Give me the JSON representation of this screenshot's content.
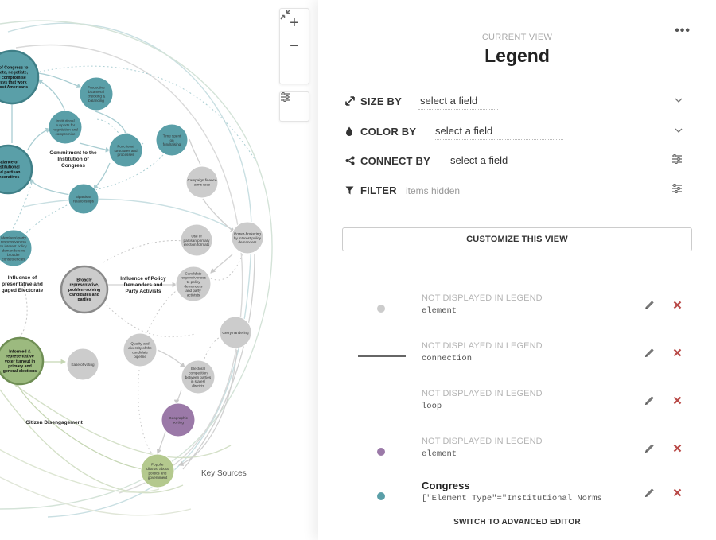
{
  "map": {
    "nodes": [
      {
        "id": "congress",
        "label": [
          "y of Congress to",
          "erate, negotiate,",
          "d compromise",
          "ways that work",
          "most Americans"
        ],
        "color": "#5a9fa8",
        "kind": "big"
      },
      {
        "id": "productive",
        "label": [
          "Productive",
          "bicameral",
          "checking &",
          "balancing"
        ],
        "color": "#5a9fa8"
      },
      {
        "id": "institutional",
        "label": [
          "Institutional",
          "supports for",
          "negotiation and",
          "compromise"
        ],
        "color": "#5a9fa8"
      },
      {
        "id": "functional",
        "label": [
          "Functional",
          "structures and",
          "processes"
        ],
        "color": "#5a9fa8"
      },
      {
        "id": "timespent",
        "label": [
          "Time spent",
          "on",
          "fundraising"
        ],
        "color": "#5a9fa8"
      },
      {
        "id": "balance",
        "label": [
          "Balance of",
          "institutional",
          "and partisan",
          "imperatives"
        ],
        "color": "#5a9fa8",
        "kind": "big"
      },
      {
        "id": "bipartisan",
        "label": [
          "Bipartisan",
          "relationships"
        ],
        "color": "#5a9fa8"
      },
      {
        "id": "campaign",
        "label": [
          "Campaign finance",
          "arms race"
        ],
        "color": "#cccccc"
      },
      {
        "id": "members",
        "label": [
          "Members'/party",
          "responsiveness",
          "to interest policy",
          "demanders vs",
          "broader",
          "constituencies"
        ],
        "color": "#5a9fa8"
      },
      {
        "id": "usepartisan",
        "label": [
          "Use of",
          "partisan primary",
          "election formats"
        ],
        "color": "#cccccc"
      },
      {
        "id": "powerbroker",
        "label": [
          "Power-brokering",
          "by interest policy",
          "demanders"
        ],
        "color": "#cccccc"
      },
      {
        "id": "broadly",
        "label": [
          "Broadly",
          "representative,",
          "problem-solving",
          "candidates and",
          "parties"
        ],
        "color": "#cccccc",
        "kind": "big"
      },
      {
        "id": "candidate",
        "label": [
          "Candidate",
          "responsiveness",
          "to policy",
          "demanders",
          "and party",
          "activists"
        ],
        "color": "#cccccc"
      },
      {
        "id": "gerrymander",
        "label": [
          "Gerrymandering"
        ],
        "color": "#cccccc"
      },
      {
        "id": "quality",
        "label": [
          "Quality and",
          "diversity of the",
          "candidate",
          "pipeline"
        ],
        "color": "#cccccc"
      },
      {
        "id": "informed",
        "label": [
          "Informed &",
          "representative",
          "voter turnout in",
          "primary and",
          "general elections"
        ],
        "color": "#9cba7f",
        "kind": "big"
      },
      {
        "id": "easevoting",
        "label": [
          "Ease of voting"
        ],
        "color": "#cccccc"
      },
      {
        "id": "electoral",
        "label": [
          "Electoral",
          "competition",
          "between parties",
          "in states/",
          "districts"
        ],
        "color": "#cccccc"
      },
      {
        "id": "geographic",
        "label": [
          "Geographic",
          "sorting"
        ],
        "color": "#9b79a8"
      },
      {
        "id": "popular",
        "label": [
          "Popular",
          "distrust about",
          "politics and",
          "government"
        ],
        "color": "#b4c98e"
      }
    ],
    "clusters": [
      {
        "id": "commitment",
        "label": [
          "Commitment to the",
          "Institution of",
          "Congress"
        ]
      },
      {
        "id": "influence-policy",
        "label": [
          "Influence of Policy",
          "Demanders and",
          "Party Activists"
        ]
      },
      {
        "id": "influence-rep",
        "label": [
          "Influence of",
          "presentative and",
          "gaged Electorate"
        ]
      },
      {
        "id": "disengagement",
        "label": [
          "Citizen Disengagement"
        ]
      }
    ],
    "key_sources": "Key Sources"
  },
  "controls": {
    "zoom_in": "+",
    "zoom_out": "−",
    "fit": "⤡"
  },
  "panel": {
    "more": "•••",
    "current_view": "CURRENT VIEW",
    "title": "Legend",
    "size_by": {
      "label": "SIZE BY",
      "value": "select a field"
    },
    "color_by": {
      "label": "COLOR BY",
      "value": "select a field"
    },
    "connect_by": {
      "label": "CONNECT BY",
      "value": "select a field"
    },
    "filter": {
      "label": "FILTER",
      "value": "items hidden"
    },
    "customize": "CUSTOMIZE THIS VIEW",
    "legend_items": [
      {
        "title": "NOT DISPLAYED IN LEGEND",
        "sub": "element",
        "swatch": "dot",
        "color": "#cccccc",
        "strong": false
      },
      {
        "title": "NOT DISPLAYED IN LEGEND",
        "sub": "connection",
        "swatch": "line",
        "color": "#666666",
        "strong": false
      },
      {
        "title": "NOT DISPLAYED IN LEGEND",
        "sub": "loop",
        "swatch": "none",
        "color": "",
        "strong": false
      },
      {
        "title": "NOT DISPLAYED IN LEGEND",
        "sub": "element",
        "swatch": "dot",
        "color": "#9b79a8",
        "strong": false
      },
      {
        "title": "Congress",
        "sub": "[\"Element Type\"=\"Institutional Norms",
        "swatch": "dot",
        "color": "#5a9fa8",
        "strong": true
      }
    ],
    "advanced": "SWITCH TO ADVANCED EDITOR"
  }
}
